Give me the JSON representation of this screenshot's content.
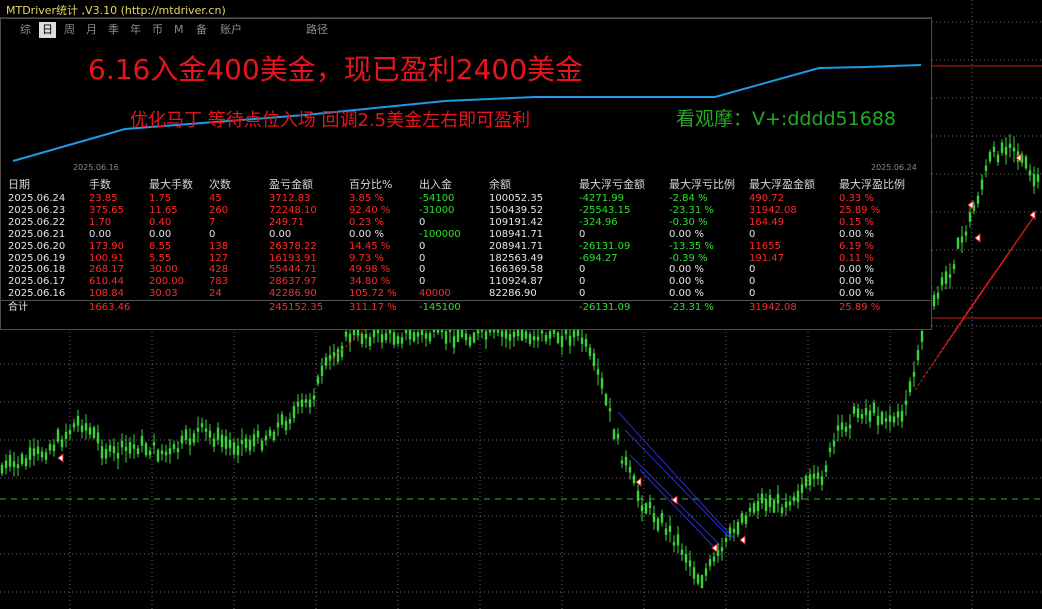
{
  "window": {
    "title": "MTDriver统计 ,V3.10 (http://mtdriver.cn)"
  },
  "tabs": [
    {
      "label": "综",
      "active": false
    },
    {
      "label": "日",
      "active": true
    },
    {
      "label": "周",
      "active": false
    },
    {
      "label": "月",
      "active": false
    },
    {
      "label": "季",
      "active": false
    },
    {
      "label": "年",
      "active": false
    },
    {
      "label": "币",
      "active": false
    },
    {
      "label": "M",
      "active": false
    },
    {
      "label": "备",
      "active": false
    },
    {
      "label": "账户",
      "active": false
    },
    {
      "label": "路径",
      "active": false
    }
  ],
  "equity_curve": {
    "start_date": "2025.06.16",
    "end_date": "2025.06.24",
    "line_color": "#1e9be6"
  },
  "overlay_text": {
    "headline": "6.16入金400美金，现已盈利2400美金",
    "subline": "优化马丁 等待点位入场  回调2.5美金左右即可盈利",
    "contact": "看观摩：V+:dddd51688"
  },
  "table": {
    "columns": [
      "日期",
      "手数",
      "最大手数",
      "次数",
      "盈亏金额",
      "百分比%",
      "出入金",
      "余额",
      "最大浮亏金额",
      "最大浮亏比例",
      "最大浮盈金额",
      "最大浮盈比例"
    ],
    "rows": [
      [
        "2025.06.24",
        "23.85",
        "1.75",
        "45",
        "3712.83",
        "3.85 %",
        "-54100",
        "100052.35",
        "-4271.99",
        "-2.84 %",
        "490.72",
        "0.33 %"
      ],
      [
        "2025.06.23",
        "375.65",
        "11.65",
        "260",
        "72248.10",
        "92.40 %",
        "-31000",
        "150439.52",
        "-25543.15",
        "-23.31 %",
        "31942.08",
        "25.89 %"
      ],
      [
        "2025.06.22",
        "1.70",
        "0.40",
        "7",
        "249.71",
        "0.23 %",
        "0",
        "109191.42",
        "-324.96",
        "-0.30 %",
        "164.49",
        "0.15 %"
      ],
      [
        "2025.06.21",
        "0.00",
        "0.00",
        "0",
        "0.00",
        "0.00 %",
        "-100000",
        "108941.71",
        "0",
        "0.00 %",
        "0",
        "0.00 %"
      ],
      [
        "2025.06.20",
        "173.90",
        "8.55",
        "138",
        "26378.22",
        "14.45 %",
        "0",
        "208941.71",
        "-26131.09",
        "-13.35 %",
        "11655",
        "6.19 %"
      ],
      [
        "2025.06.19",
        "100.91",
        "5.55",
        "127",
        "16193.91",
        "9.73 %",
        "0",
        "182563.49",
        "-694.27",
        "-0.39 %",
        "191.47",
        "0.11 %"
      ],
      [
        "2025.06.18",
        "268.17",
        "30.00",
        "428",
        "55444.71",
        "49.98 %",
        "0",
        "166369.58",
        "0",
        "0.00 %",
        "0",
        "0.00 %"
      ],
      [
        "2025.06.17",
        "610.44",
        "200.00",
        "783",
        "28637.97",
        "34.80 %",
        "0",
        "110924.87",
        "0",
        "0.00 %",
        "0",
        "0.00 %"
      ],
      [
        "2025.06.16",
        "108.84",
        "30.03",
        "24",
        "42286.90",
        "105.72 %",
        "40000",
        "82286.90",
        "0",
        "0.00 %",
        "0",
        "0.00 %"
      ]
    ],
    "total": [
      "合计",
      "1663.46",
      "",
      "",
      "245152.35",
      "311.17 %",
      "-145100",
      "",
      "-26131.09",
      "-23.31 %",
      "31942.08",
      "25.89 %"
    ]
  },
  "colors": {
    "background": "#000000",
    "grid": "#6a6a6a",
    "candle": "#39d439",
    "loss_text": "#ff2a2a",
    "gain_text": "#2ee02e",
    "level_line": "#cc1a1a"
  }
}
